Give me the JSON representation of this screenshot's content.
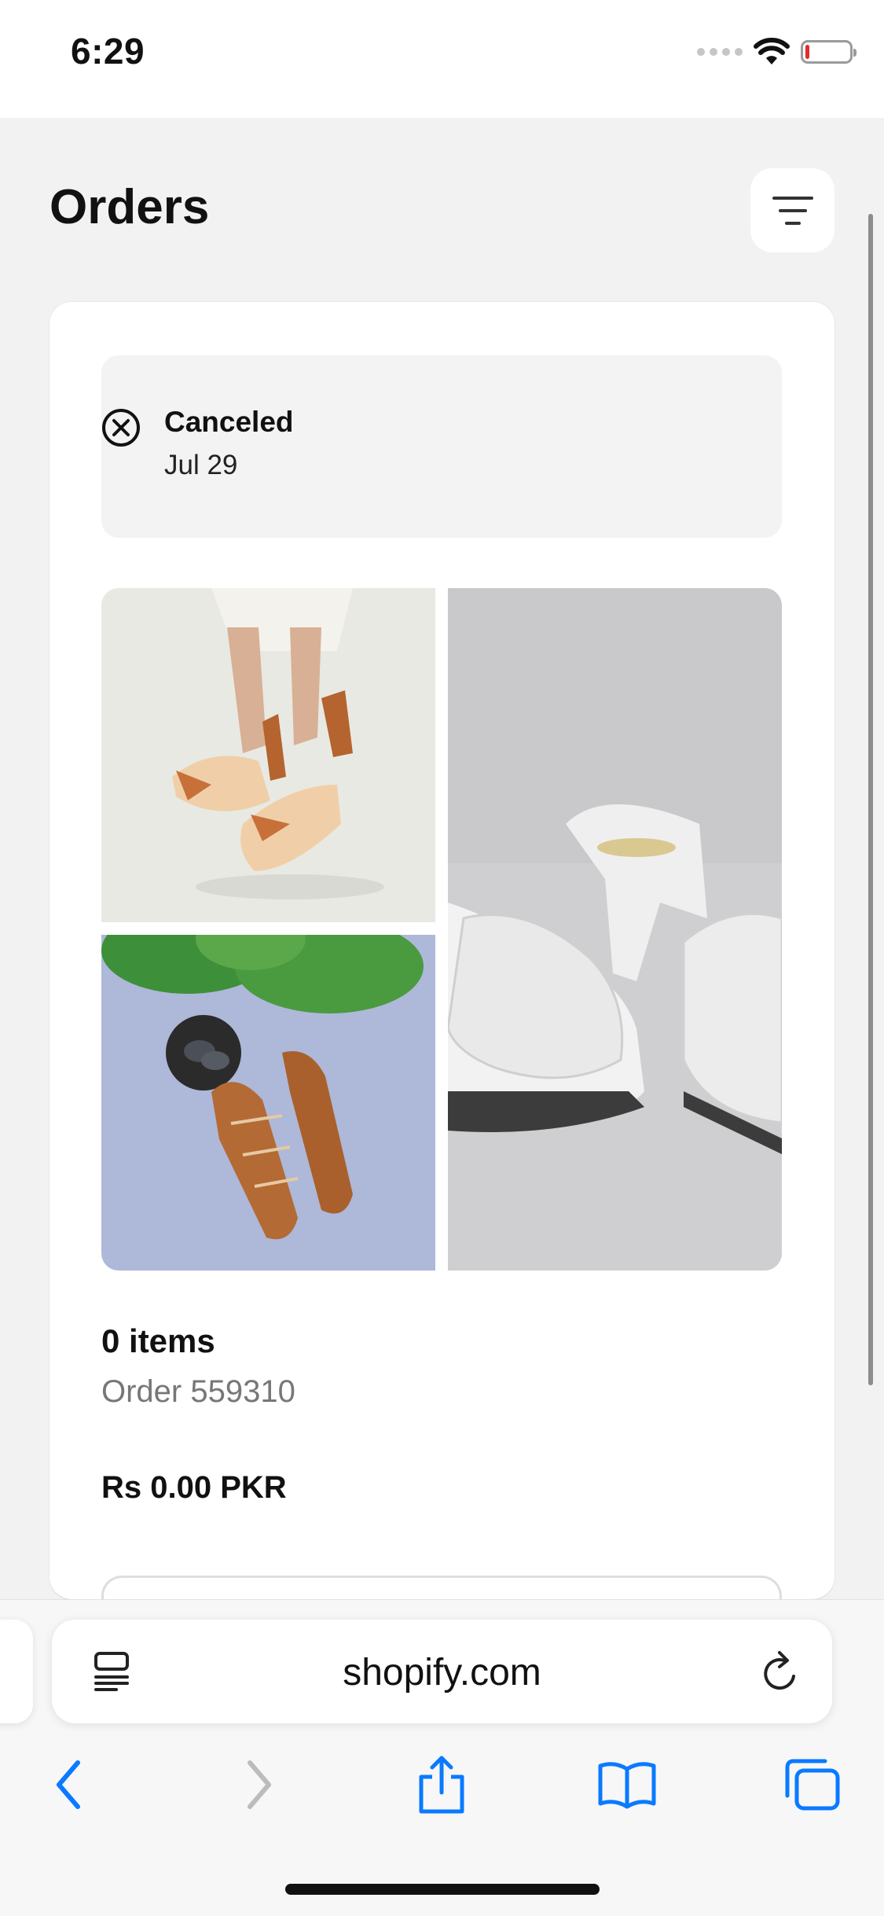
{
  "status_bar": {
    "time": "6:29"
  },
  "page": {
    "title": "Orders"
  },
  "order": {
    "status": "Canceled",
    "date": "Jul 29",
    "items_count": "0 items",
    "order_number": "Order 559310",
    "total": "Rs 0.00 PKR"
  },
  "browser": {
    "url": "shopify.com"
  },
  "icons": {
    "filter": "filter-icon",
    "status": "x-circle-icon",
    "reader": "reader-mode-icon",
    "reload": "reload-icon",
    "back": "back-chevron-icon",
    "forward": "forward-chevron-icon",
    "share": "share-icon",
    "bookmarks": "book-icon",
    "tabs": "tabs-icon"
  },
  "colors": {
    "link_blue": "#0a7aff",
    "battery_low": "#e22b2b"
  },
  "battery_level": 0.05
}
